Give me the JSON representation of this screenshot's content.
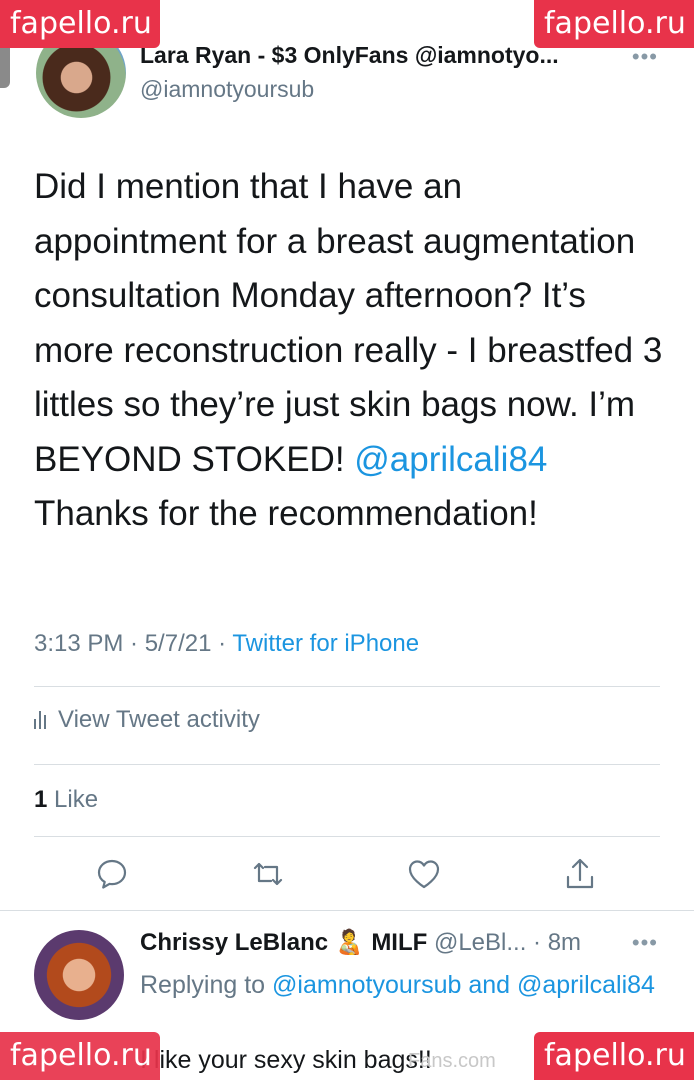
{
  "watermark": {
    "text": "fapello.ru"
  },
  "tweet": {
    "author_line": "Lara Ryan - $3 OnlyFans @iamnotyo...",
    "more": "•••",
    "handle": "@iamnotyoursub",
    "text_part1": "Did I mention that I have an appointment for a breast augmentation consultation Monday afternoon? It’s more reconstruction really - I breastfed 3 littles so they’re just skin bags now. I’m BEYOND STOKED! ",
    "mention": "@aprilcali84",
    "text_part2": " Thanks for the recommendation!",
    "time": "3:13 PM · 5/7/21 · ",
    "source": "Twitter for iPhone",
    "activity_label": "View Tweet activity",
    "like_count": "1",
    "like_label": " Like"
  },
  "actions": [
    {
      "icon": "reply-icon"
    },
    {
      "icon": "retweet-icon"
    },
    {
      "icon": "heart-icon"
    },
    {
      "icon": "share-icon"
    }
  ],
  "reply": {
    "name": "Chrissy LeBlanc",
    "emoji": "🧑‍🍼",
    "badge": "MILF",
    "handle": " @LeBl... · 8m",
    "more": "•••",
    "replying_prefix": "Replying to ",
    "replying_to_1": "@iamnotyoursub",
    "replying_and": " and ",
    "replying_to_2": "@aprilcali84",
    "text": "I like your sexy skin bags!!",
    "faint_mark": "Fans.com"
  },
  "colors": {
    "accent": "#1b95e0",
    "watermark": "#e8334a",
    "muted": "#657786"
  }
}
